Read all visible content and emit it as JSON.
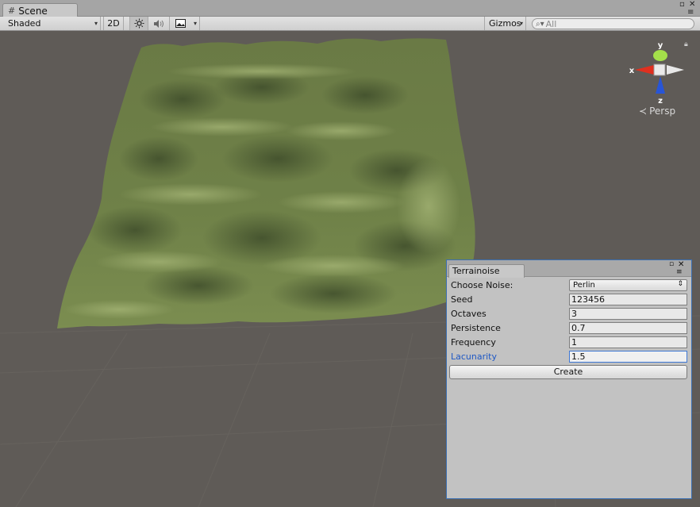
{
  "tab": {
    "label": "Scene",
    "icon": "grid-icon"
  },
  "toolbar": {
    "shading_mode": "Shaded",
    "mode_2d": "2D",
    "lighting_icon": "sun-icon",
    "audio_icon": "speaker-icon",
    "effects_icon": "image-icon",
    "gizmos_label": "Gizmos",
    "search_placeholder": "All"
  },
  "gizmo": {
    "y": "y",
    "x": "x",
    "z": "z",
    "projection": "Persp"
  },
  "terrainoise": {
    "title": "Terrainoise",
    "fields": {
      "choose_noise_label": "Choose Noise:",
      "choose_noise_value": "Perlin",
      "seed_label": "Seed",
      "seed_value": "123456",
      "octaves_label": "Octaves",
      "octaves_value": "3",
      "persistence_label": "Persistence",
      "persistence_value": "0.7",
      "frequency_label": "Frequency",
      "frequency_value": "1",
      "lacunarity_label": "Lacunarity",
      "lacunarity_value": "1.5"
    },
    "create_label": "Create"
  },
  "colors": {
    "scene_bg": "#5f5b57",
    "terrain": "#6f8148",
    "focus_accent": "#3f78d4"
  }
}
